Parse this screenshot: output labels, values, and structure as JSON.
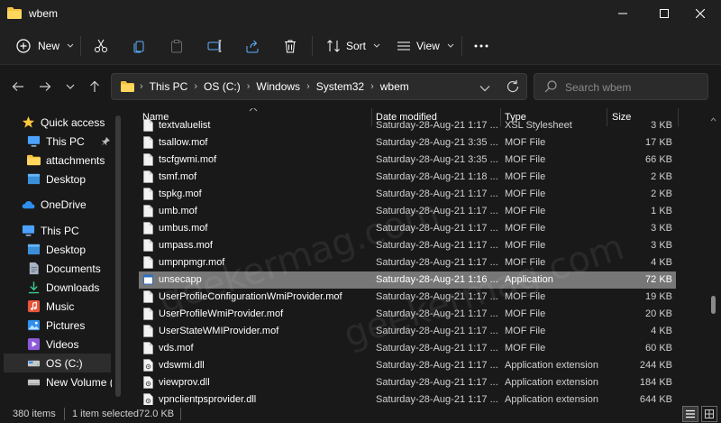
{
  "window": {
    "title": "wbem",
    "controls": [
      "minimize-icon",
      "maximize-icon",
      "close-icon"
    ]
  },
  "toolbar": {
    "new_label": "New",
    "sort_label": "Sort",
    "view_label": "View",
    "icons": [
      "cut-icon",
      "copy-icon",
      "paste-icon",
      "rename-icon",
      "share-icon",
      "delete-icon",
      "more-icon"
    ]
  },
  "address": {
    "crumbs": [
      "This PC",
      "OS (C:)",
      "Windows",
      "System32",
      "wbem"
    ]
  },
  "search": {
    "placeholder": "Search wbem"
  },
  "sidebar": {
    "items": [
      {
        "label": "Quick access",
        "icon": "star-icon"
      },
      {
        "label": "This PC",
        "icon": "monitor-icon"
      },
      {
        "label": "attachments",
        "icon": "folder-icon"
      },
      {
        "label": "Desktop",
        "icon": "desktop-icon"
      },
      {
        "label": "OneDrive",
        "icon": "cloud-icon"
      },
      {
        "label": "This PC",
        "icon": "monitor-icon"
      },
      {
        "label": "Desktop",
        "icon": "desktop-icon"
      },
      {
        "label": "Documents",
        "icon": "documents-icon"
      },
      {
        "label": "Downloads",
        "icon": "download-icon"
      },
      {
        "label": "Music",
        "icon": "music-icon"
      },
      {
        "label": "Pictures",
        "icon": "pictures-icon"
      },
      {
        "label": "Videos",
        "icon": "videos-icon"
      },
      {
        "label": "OS (C:)",
        "icon": "drive-icon"
      },
      {
        "label": "New Volume (D:",
        "icon": "drive-icon"
      }
    ],
    "selected": "OS (C:)"
  },
  "columns": {
    "name": "Name",
    "date": "Date modified",
    "type": "Type",
    "size": "Size"
  },
  "files": [
    {
      "name": "textvaluelist",
      "date": "Saturday-28-Aug-21 1:17 ...",
      "type": "XSL Stylesheet",
      "size": "3 KB"
    },
    {
      "name": "tsallow.mof",
      "date": "Saturday-28-Aug-21 3:35 ...",
      "type": "MOF File",
      "size": "17 KB"
    },
    {
      "name": "tscfgwmi.mof",
      "date": "Saturday-28-Aug-21 3:35 ...",
      "type": "MOF File",
      "size": "66 KB"
    },
    {
      "name": "tsmf.mof",
      "date": "Saturday-28-Aug-21 1:18 ...",
      "type": "MOF File",
      "size": "2 KB"
    },
    {
      "name": "tspkg.mof",
      "date": "Saturday-28-Aug-21 1:17 ...",
      "type": "MOF File",
      "size": "2 KB"
    },
    {
      "name": "umb.mof",
      "date": "Saturday-28-Aug-21 1:17 ...",
      "type": "MOF File",
      "size": "1 KB"
    },
    {
      "name": "umbus.mof",
      "date": "Saturday-28-Aug-21 1:17 ...",
      "type": "MOF File",
      "size": "3 KB"
    },
    {
      "name": "umpass.mof",
      "date": "Saturday-28-Aug-21 1:17 ...",
      "type": "MOF File",
      "size": "3 KB"
    },
    {
      "name": "umpnpmgr.mof",
      "date": "Saturday-28-Aug-21 1:17 ...",
      "type": "MOF File",
      "size": "4 KB"
    },
    {
      "name": "unsecapp",
      "date": "Saturday-28-Aug-21 1:16 ...",
      "type": "Application",
      "size": "72 KB"
    },
    {
      "name": "UserProfileConfigurationWmiProvider.mof",
      "date": "Saturday-28-Aug-21 1:17 ...",
      "type": "MOF File",
      "size": "19 KB"
    },
    {
      "name": "UserProfileWmiProvider.mof",
      "date": "Saturday-28-Aug-21 1:17 ...",
      "type": "MOF File",
      "size": "20 KB"
    },
    {
      "name": "UserStateWMIProvider.mof",
      "date": "Saturday-28-Aug-21 1:17 ...",
      "type": "MOF File",
      "size": "4 KB"
    },
    {
      "name": "vds.mof",
      "date": "Saturday-28-Aug-21 1:17 ...",
      "type": "MOF File",
      "size": "60 KB"
    },
    {
      "name": "vdswmi.dll",
      "date": "Saturday-28-Aug-21 1:17 ...",
      "type": "Application extension",
      "size": "244 KB"
    },
    {
      "name": "viewprov.dll",
      "date": "Saturday-28-Aug-21 1:17 ...",
      "type": "Application extension",
      "size": "184 KB"
    },
    {
      "name": "vpnclientpsprovider.dll",
      "date": "Saturday-28-Aug-21 1:17 ...",
      "type": "Application extension",
      "size": "644 KB"
    }
  ],
  "selected_file": "unsecapp",
  "status": {
    "items": "380 items",
    "selected": "1 item selected",
    "size": "72.0 KB"
  },
  "watermark": "geekermag.com",
  "colors": {
    "background": "#191919",
    "chrome": "#202020",
    "selection": "#777777",
    "folder": "#f5c342",
    "accent": "#4ca3ff"
  }
}
